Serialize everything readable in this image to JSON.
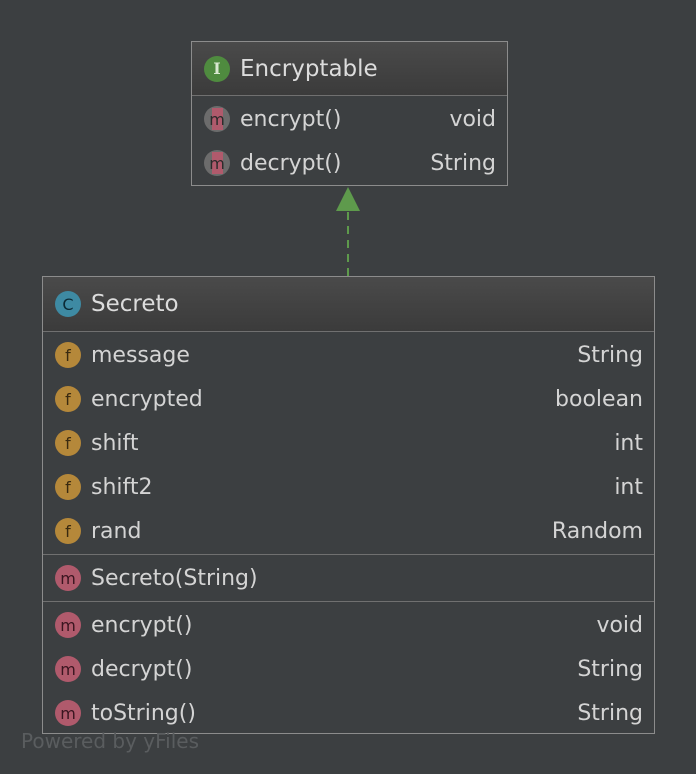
{
  "interface_box": {
    "stereotype_icon": "interface-icon",
    "stereotype_letter": "I",
    "name": "Encryptable",
    "methods": [
      {
        "icon": "abstract-method-icon",
        "letter": "m",
        "name": "encrypt()",
        "type": "void"
      },
      {
        "icon": "abstract-method-icon",
        "letter": "m",
        "name": "decrypt()",
        "type": "String"
      }
    ]
  },
  "class_box": {
    "stereotype_icon": "class-icon",
    "stereotype_letter": "C",
    "name": "Secreto",
    "fields": [
      {
        "icon": "field-icon",
        "letter": "f",
        "name": "message",
        "type": "String"
      },
      {
        "icon": "field-icon",
        "letter": "f",
        "name": "encrypted",
        "type": "boolean"
      },
      {
        "icon": "field-icon",
        "letter": "f",
        "name": "shift",
        "type": "int"
      },
      {
        "icon": "field-icon",
        "letter": "f",
        "name": "shift2",
        "type": "int"
      },
      {
        "icon": "field-icon",
        "letter": "f",
        "name": "rand",
        "type": "Random"
      }
    ],
    "constructors": [
      {
        "icon": "method-icon",
        "letter": "m",
        "name": "Secreto(String)",
        "type": ""
      }
    ],
    "methods": [
      {
        "icon": "method-icon",
        "letter": "m",
        "name": "encrypt()",
        "type": "void"
      },
      {
        "icon": "method-icon",
        "letter": "m",
        "name": "decrypt()",
        "type": "String"
      },
      {
        "icon": "method-icon",
        "letter": "m",
        "name": "toString()",
        "type": "String"
      }
    ]
  },
  "relationship": {
    "kind": "realization",
    "from": "Secreto",
    "to": "Encryptable",
    "color": "#5e9a4c"
  },
  "colors": {
    "background": "#3c3f41",
    "border": "#8c8c8c",
    "interface_badge": "#4f8b3f",
    "class_badge": "#3e8aa3",
    "field_badge": "#b5883a",
    "method_badge": "#b05a6c"
  },
  "watermark": "Powered by yFiles"
}
